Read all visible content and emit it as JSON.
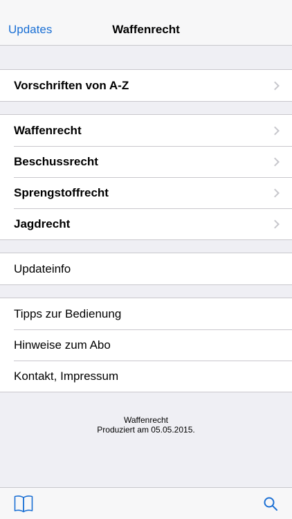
{
  "navbar": {
    "back_label": "Updates",
    "title": "Waffenrecht"
  },
  "groups": {
    "az": [
      {
        "label": "Vorschriften von A-Z"
      }
    ],
    "law": [
      {
        "label": "Waffenrecht"
      },
      {
        "label": "Beschussrecht"
      },
      {
        "label": "Sprengstoffrecht"
      },
      {
        "label": "Jagdrecht"
      }
    ],
    "update": [
      {
        "label": "Updateinfo"
      }
    ],
    "info": [
      {
        "label": "Tipps zur Bedienung"
      },
      {
        "label": "Hinweise zum Abo"
      },
      {
        "label": "Kontakt, Impressum"
      }
    ]
  },
  "footer": {
    "line1": "Waffenrecht",
    "line2": "Produziert am 05.05.2015."
  },
  "tabbar": {
    "left_icon": "book-icon",
    "right_icon": "search-icon"
  },
  "colors": {
    "accent": "#1a6fd4",
    "background": "#efeff4",
    "separator": "#c8c7cc",
    "chevron": "#c7c7cc"
  }
}
